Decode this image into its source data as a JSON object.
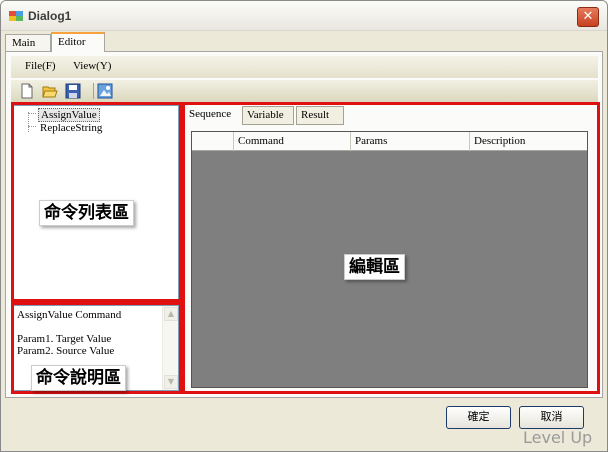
{
  "window": {
    "title": "Dialog1",
    "close_glyph": "✕"
  },
  "tabs": [
    {
      "label": "Main"
    },
    {
      "label": "Editor",
      "active": true
    }
  ],
  "menu": [
    {
      "label": "File(F)"
    },
    {
      "label": "View(Y)"
    }
  ],
  "toolbar": {
    "icons": [
      "new-file-icon",
      "open-folder-icon",
      "save-icon",
      "picture-icon"
    ]
  },
  "command_list": {
    "items": [
      {
        "label": "AssignValue",
        "selected": true
      },
      {
        "label": "ReplaceString"
      }
    ]
  },
  "description": {
    "lines": [
      "AssignValue Command",
      "",
      "Param1. Target Value",
      "Param2. Source Value"
    ]
  },
  "editor": {
    "tabs": [
      {
        "label": "Sequence"
      },
      {
        "label": "Variable"
      },
      {
        "label": "Result"
      }
    ],
    "columns": [
      "",
      "Command",
      "Params",
      "Description"
    ]
  },
  "annotations": {
    "command_list": "命令列表區",
    "description": "命令說明區",
    "editor": "編輯區"
  },
  "buttons": {
    "ok": "確定",
    "cancel": "取消"
  },
  "watermark": "Level Up",
  "colors": {
    "annotation_border": "#e01010",
    "grid_background": "#7f7f7f",
    "active_tab_accent": "#f7a13f",
    "close_button": "#c7401f"
  }
}
